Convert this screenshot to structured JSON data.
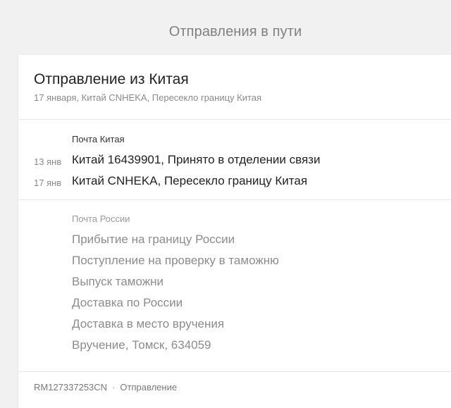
{
  "page": {
    "title": "Отправления в пути"
  },
  "shipment": {
    "title": "Отправление из Китая",
    "subtitle": "17 января, Китай CNHEKA, Пересекло границу Китая",
    "tracking_number": "RM127337253CN",
    "separator": "·",
    "type_label": "Отправление"
  },
  "china": {
    "carrier": "Почта Китая",
    "events": [
      {
        "date": "13 янв",
        "text": "Китай 16439901, Принято в отделении связи"
      },
      {
        "date": "17 янв",
        "text": "Китай CNHEKA, Пересекло границу Китая"
      }
    ]
  },
  "russia": {
    "carrier": "Почта России",
    "stages": [
      "Прибытие на границу России",
      "Поступление на проверку в таможню",
      "Выпуск таможни",
      "Доставка по России",
      "Доставка в место вручения",
      "Вручение, Томск, 634059"
    ]
  },
  "colors": {
    "background": "#f1f1f1",
    "card": "#ffffff",
    "primary_text": "#222222",
    "muted_text": "#8c8c8c",
    "divider": "#e6e6e6"
  }
}
